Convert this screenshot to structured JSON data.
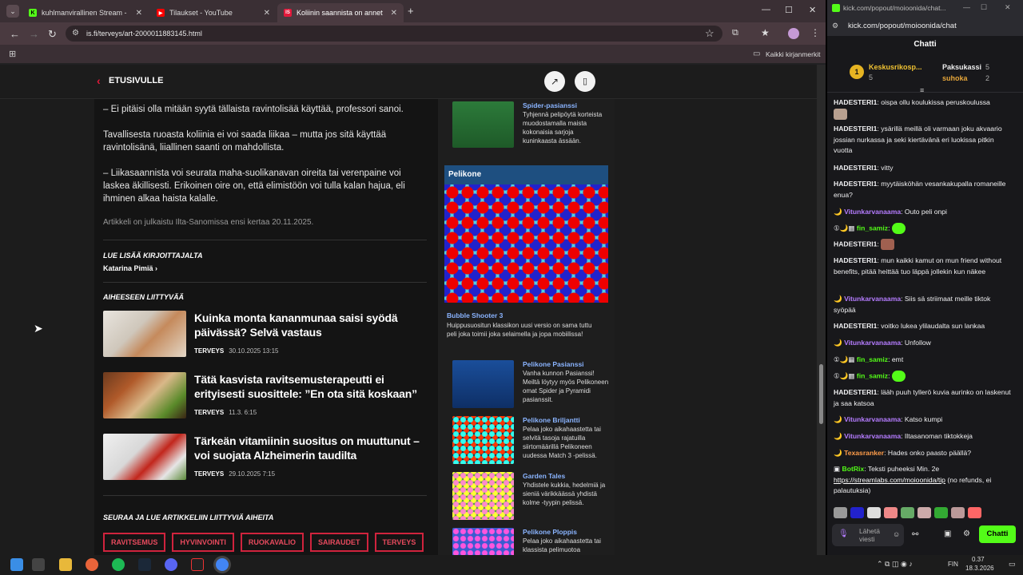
{
  "browser": {
    "tabs": [
      {
        "title": "kuhlmanvirallinen Stream - Wat",
        "favicon": "K",
        "color": "#53fc18"
      },
      {
        "title": "Tilaukset - YouTube",
        "favicon": "▶",
        "color": "#ff0000"
      },
      {
        "title": "Koliinin saannista on annettu e",
        "favicon": "IS",
        "color": "#e3193b"
      }
    ],
    "url": "is.fi/terveys/art-2000011883145.html",
    "bookmarks_label": "Kaikki kirjanmerkit"
  },
  "page": {
    "back_label": "ETUSIVULLE",
    "paragraphs": [
      "– Ei pitäisi olla mitään syytä tällaista ravintolisää käyttää, professori sanoi.",
      "Tavallisesta ruoasta koliinia ei voi saada liikaa – mutta jos sitä käyttää ravintolisänä, liiallinen saanti on mahdollista.",
      "– Liikasaannista voi seurata maha-suolikanavan oireita tai verenpaine voi laskea äkillisesti. Erikoinen oire on, että elimistöön voi tulla kalan hajua, eli ihminen alkaa haista kalalle."
    ],
    "published_note": "Artikkeli on julkaistu Ilta-Sanomissa ensi kertaa 20.11.2025.",
    "author_heading": "LUE LISÄÄ KIRJOITTAJALTA",
    "author_name": "Katarina Pimiä",
    "related_heading": "AIHEESEEN LIITTYVÄÄ",
    "related": [
      {
        "title": "Kuinka monta kananmunaa saisi syödä päivässä? Selvä vastaus",
        "section": "TERVEYS",
        "date": "30.10.2025 13:15"
      },
      {
        "title": "Tätä kasvista ravitsemusterapeutti ei erityisesti suosittele: ”En ota sitä koskaan”",
        "section": "TERVEYS",
        "date": "11.3. 6:15"
      },
      {
        "title": "Tärkeän vitamiinin suositus on muuttunut – voi suojata Alzheimerin taudilta",
        "section": "TERVEYS",
        "date": "29.10.2025 7:15"
      }
    ],
    "follow_heading": "SEURAA JA LUE ARTIKKELIIN LIITTYVIÄ AIHEITA",
    "tags": [
      "RAVITSEMUS",
      "HYVINVOINTI",
      "RUOKAVALIO",
      "SAIRAUDET",
      "TERVEYS"
    ],
    "sidebar": {
      "top_game": {
        "title": "Spider-pasianssi",
        "desc": "Tyhjennä pelipöytä korteista muodostamalla maista kokonaisia sarjoja kuninkaasta ässään."
      },
      "pelikone_label": "Pelikone",
      "featured": {
        "title": "Bubble Shooter 3",
        "desc": "Huippusuositun klassikon uusi versio on sama tuttu peli joka toimii joka selaimella ja jopa mobiilissa!"
      },
      "games": [
        {
          "title": "Pelikone Pasianssi",
          "desc": "Vanha kunnon Pasianssi! Meiltä löytyy myös Pelikoneen omat Spider ja Pyramidi pasianssit."
        },
        {
          "title": "Pelikone Briljantti",
          "desc": "Pelaa joko aikahaastetta tai selvitä tasoja rajatuilla siirtomäärillä Pelikoneen uudessa Match 3 -pelissä."
        },
        {
          "title": "Garden Tales",
          "desc": "Yhdistele kukkia, hedelmiä ja sieniä värikkäässä yhdistä kolme -tyypin pelissä."
        },
        {
          "title": "Pelikone Ploppis",
          "desc": "Pelaa joko aikahaastetta tai klassista pelimuotoa"
        }
      ]
    }
  },
  "popup": {
    "url_title": "kick.com/popout/moioonida/chat...",
    "url": "kick.com/popout/moioonida/chat",
    "chat_title": "Chatti",
    "pinned": {
      "left_name": "Keskusrikosp...",
      "left_count": "5",
      "right1_name": "Paksukassi",
      "right1_count": "5",
      "right2_name": "suhoka",
      "right2_count": "2"
    },
    "messages": [
      {
        "user": "HADESTERI1",
        "color": "#ffffff",
        "text": "oispa ollu koulukissa peruskoulussa"
      },
      {
        "user": "HADESTERI1",
        "color": "#ffffff",
        "text": "ysärillä meillä oli varmaan joku akvaario jossian nurkassa ja seki kiertävänä eri luokissa pitkin vuotta"
      },
      {
        "user": "HADESTERI1",
        "color": "#ffffff",
        "text": "vitty"
      },
      {
        "user": "HADESTERI1",
        "color": "#ffffff",
        "text": "myytäisköhän vesankakupalla romaneille enua?"
      },
      {
        "user": "Vitunkarvanaama",
        "color": "#b57cff",
        "text": "Outo peli onpi"
      },
      {
        "user": "fin_samiz",
        "color": "#53fc18",
        "text": ""
      },
      {
        "user": "HADESTERI1",
        "color": "#ffffff",
        "text": ""
      },
      {
        "user": "HADESTERI1",
        "color": "#ffffff",
        "text": "mun kaikki kamut on mun friend without benefits, pitää heittää tuo läppä jollekin kun näkee"
      },
      {
        "user": "Vitunkarvanaama",
        "color": "#b57cff",
        "text": "Siis sä striimaat meille tiktok syöpää"
      },
      {
        "user": "HADESTERI1",
        "color": "#ffffff",
        "text": "voitko lukea ylilaudalta sun lankaa"
      },
      {
        "user": "Vitunkarvanaama",
        "color": "#b57cff",
        "text": "Unfollow"
      },
      {
        "user": "fin_samiz",
        "color": "#53fc18",
        "text": "emt"
      },
      {
        "user": "fin_samiz",
        "color": "#53fc18",
        "text": ""
      },
      {
        "user": "HADESTERI1",
        "color": "#ffffff",
        "text": "lääh puuh tyllerö kuvia aurinko on laskenut ja saa katsoa"
      },
      {
        "user": "Vitunkarvanaama",
        "color": "#b57cff",
        "text": "Katso kumpi"
      },
      {
        "user": "Vitunkarvanaama",
        "color": "#b57cff",
        "text": "Iltasanoman tiktokkeja"
      },
      {
        "user": "Texasranker",
        "color": "#ff9d4a",
        "text": "Hades onko paasto päällä?"
      },
      {
        "user": "BotRix",
        "color": "#53fc18",
        "text": "Teksti puheeksi Min. 2e",
        "link": "https://streamlabs.com/moioonida/tip",
        "after": "(no refunds, ei palautuksia)"
      }
    ],
    "input_placeholder": "Lähetä viesti",
    "send_label": "Chatti"
  },
  "taskbar": {
    "lang": "FIN",
    "time": "0.37",
    "date": "18.3.2026"
  }
}
